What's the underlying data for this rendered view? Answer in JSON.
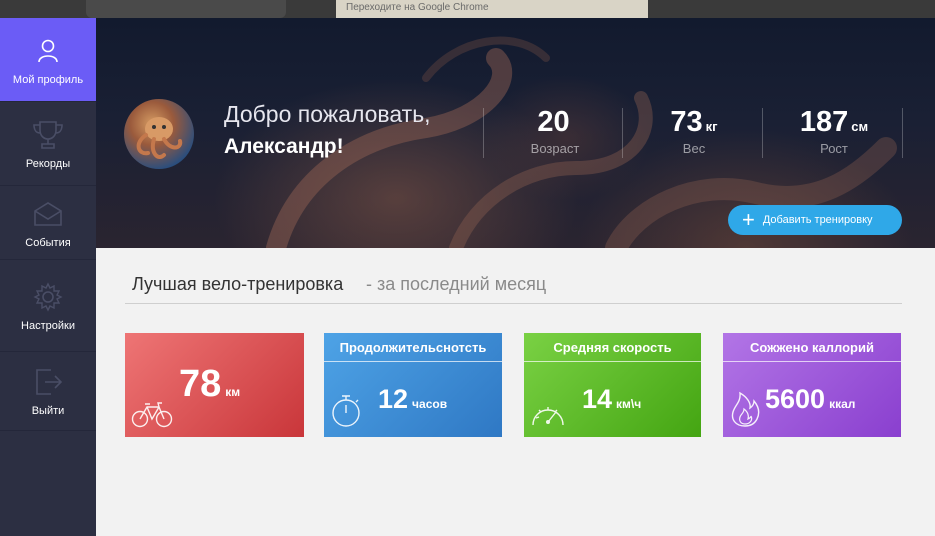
{
  "browser": {
    "tab_text": "Переходите на Google Chrome"
  },
  "sidebar": {
    "items": [
      {
        "label": "Мой профиль",
        "icon": "user-icon",
        "active": true
      },
      {
        "label": "Рекорды",
        "icon": "trophy-icon",
        "active": false
      },
      {
        "label": "События",
        "icon": "envelope-icon",
        "active": false
      },
      {
        "label": "Настройки",
        "icon": "gear-icon",
        "active": false
      },
      {
        "label": "Выйти",
        "icon": "exit-icon",
        "active": false
      }
    ]
  },
  "hero": {
    "greeting": "Добро пожаловать,",
    "username": "Александр!",
    "stats": [
      {
        "value": "20",
        "unit": "",
        "caption": "Возраст"
      },
      {
        "value": "73",
        "unit": "кг",
        "caption": "Вес"
      },
      {
        "value": "187",
        "unit": "см",
        "caption": "Рост"
      }
    ],
    "add_button_label": "Добавить тренировку"
  },
  "section": {
    "title": "Лучшая вело-тренировка",
    "subtitle": "-   за последний месяц"
  },
  "cards": [
    {
      "header": "",
      "value": "78",
      "unit": "км",
      "icon": "bicycle-icon",
      "color": "#e45a5a"
    },
    {
      "header": "Продолжительснотсть",
      "value": "12",
      "unit": "часов",
      "icon": "stopwatch-icon",
      "color": "#3d8fd8"
    },
    {
      "header": "Средняя скорость",
      "value": "14",
      "unit": "км\\ч",
      "icon": "speedometer-icon",
      "color": "#5cbf2a"
    },
    {
      "header": "Сожжено каллорий",
      "value": "5600",
      "unit": "ккал",
      "icon": "flame-icon",
      "color": "#9a52d8"
    }
  ],
  "colors": {
    "sidebar_bg": "#2c2f42",
    "sidebar_active": "#6b5cf6",
    "add_button": "#2fa8e8"
  }
}
